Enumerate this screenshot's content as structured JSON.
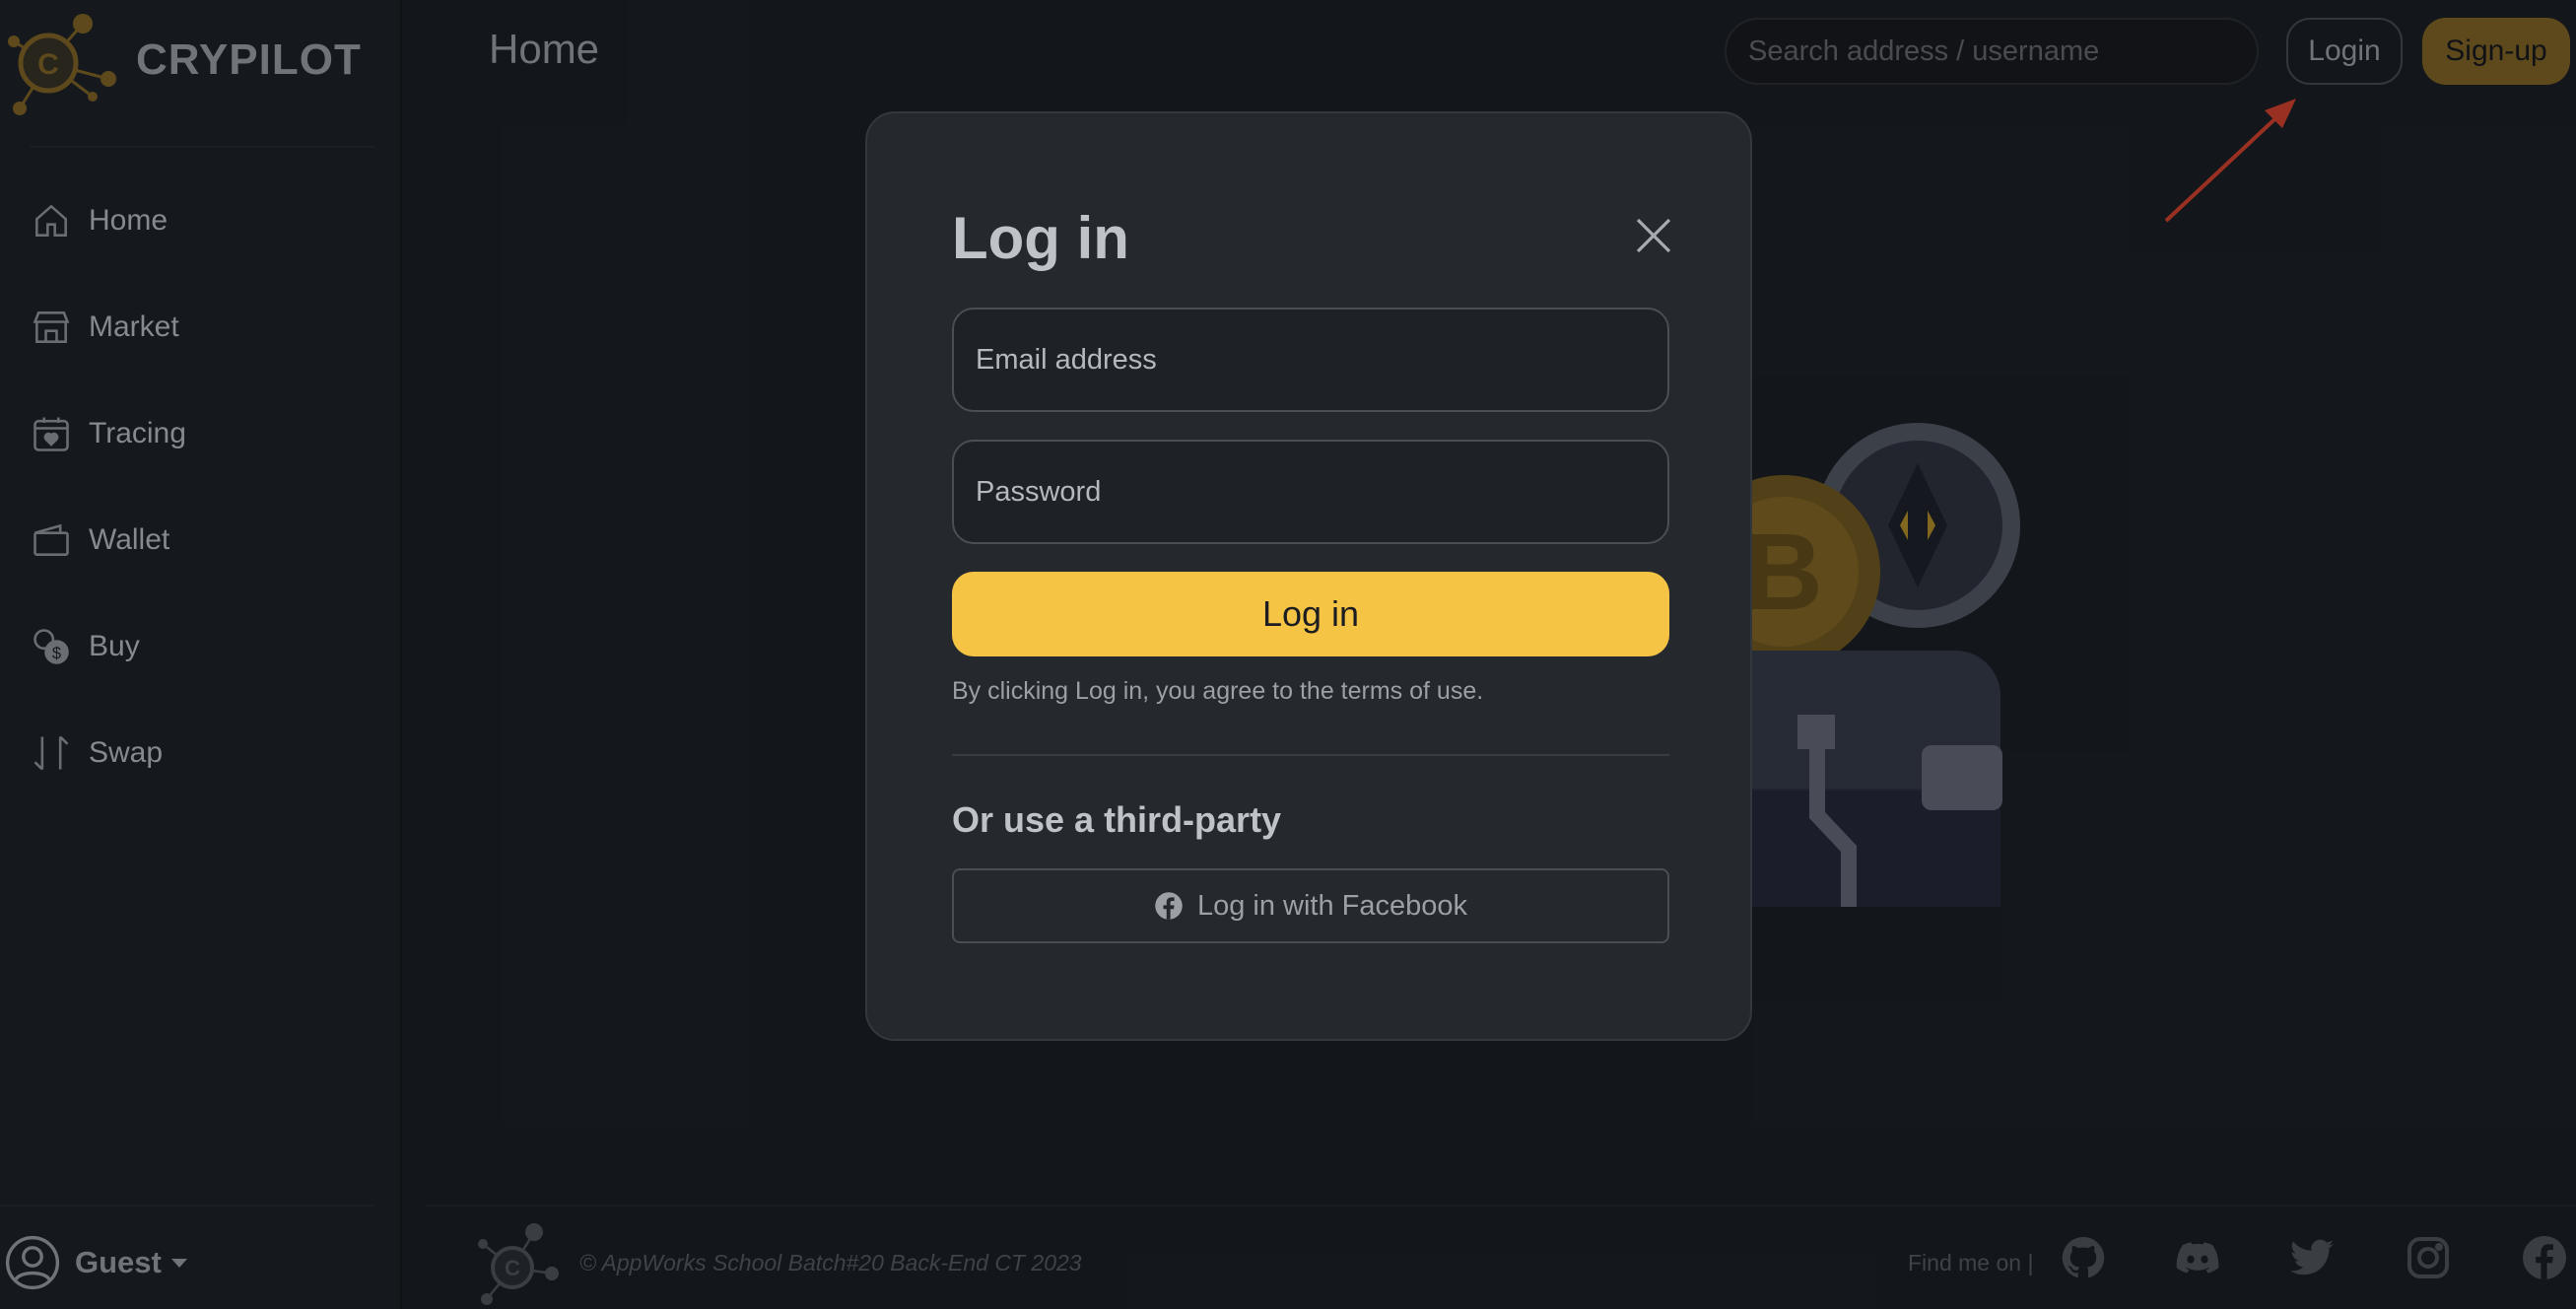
{
  "brand": {
    "name": "CRYPILOT",
    "logo_icon": "crypilot-logo-icon"
  },
  "sidebar": {
    "items": [
      {
        "label": "Home",
        "icon": "home-icon"
      },
      {
        "label": "Market",
        "icon": "store-icon"
      },
      {
        "label": "Tracing",
        "icon": "calendar-heart-icon"
      },
      {
        "label": "Wallet",
        "icon": "wallet-icon"
      },
      {
        "label": "Buy",
        "icon": "coins-icon"
      },
      {
        "label": "Swap",
        "icon": "swap-arrows-icon"
      }
    ],
    "user": {
      "name": "Guest",
      "icon": "user-circle-icon"
    }
  },
  "header": {
    "title": "Home",
    "search_placeholder": "Search address / username",
    "login_label": "Login",
    "signup_label": "Sign-up"
  },
  "modal": {
    "title": "Log in",
    "email_placeholder": "Email address",
    "password_placeholder": "Password",
    "submit_label": "Log in",
    "terms": "By clicking Log in, you agree to the terms of use.",
    "third_party_heading": "Or use a third-party",
    "facebook_label": "Log in with Facebook"
  },
  "footer": {
    "copyright": "© AppWorks School Batch#20 Back-End CT 2023",
    "find_me": "Find me on |",
    "socials": [
      "github-icon",
      "discord-icon",
      "twitter-icon",
      "instagram-icon",
      "facebook-icon"
    ]
  },
  "colors": {
    "accent_yellow": "#f6c444",
    "signup_gold": "#8a6a24",
    "annotation_arrow": "#e8442c",
    "background": "#1a1d22"
  }
}
